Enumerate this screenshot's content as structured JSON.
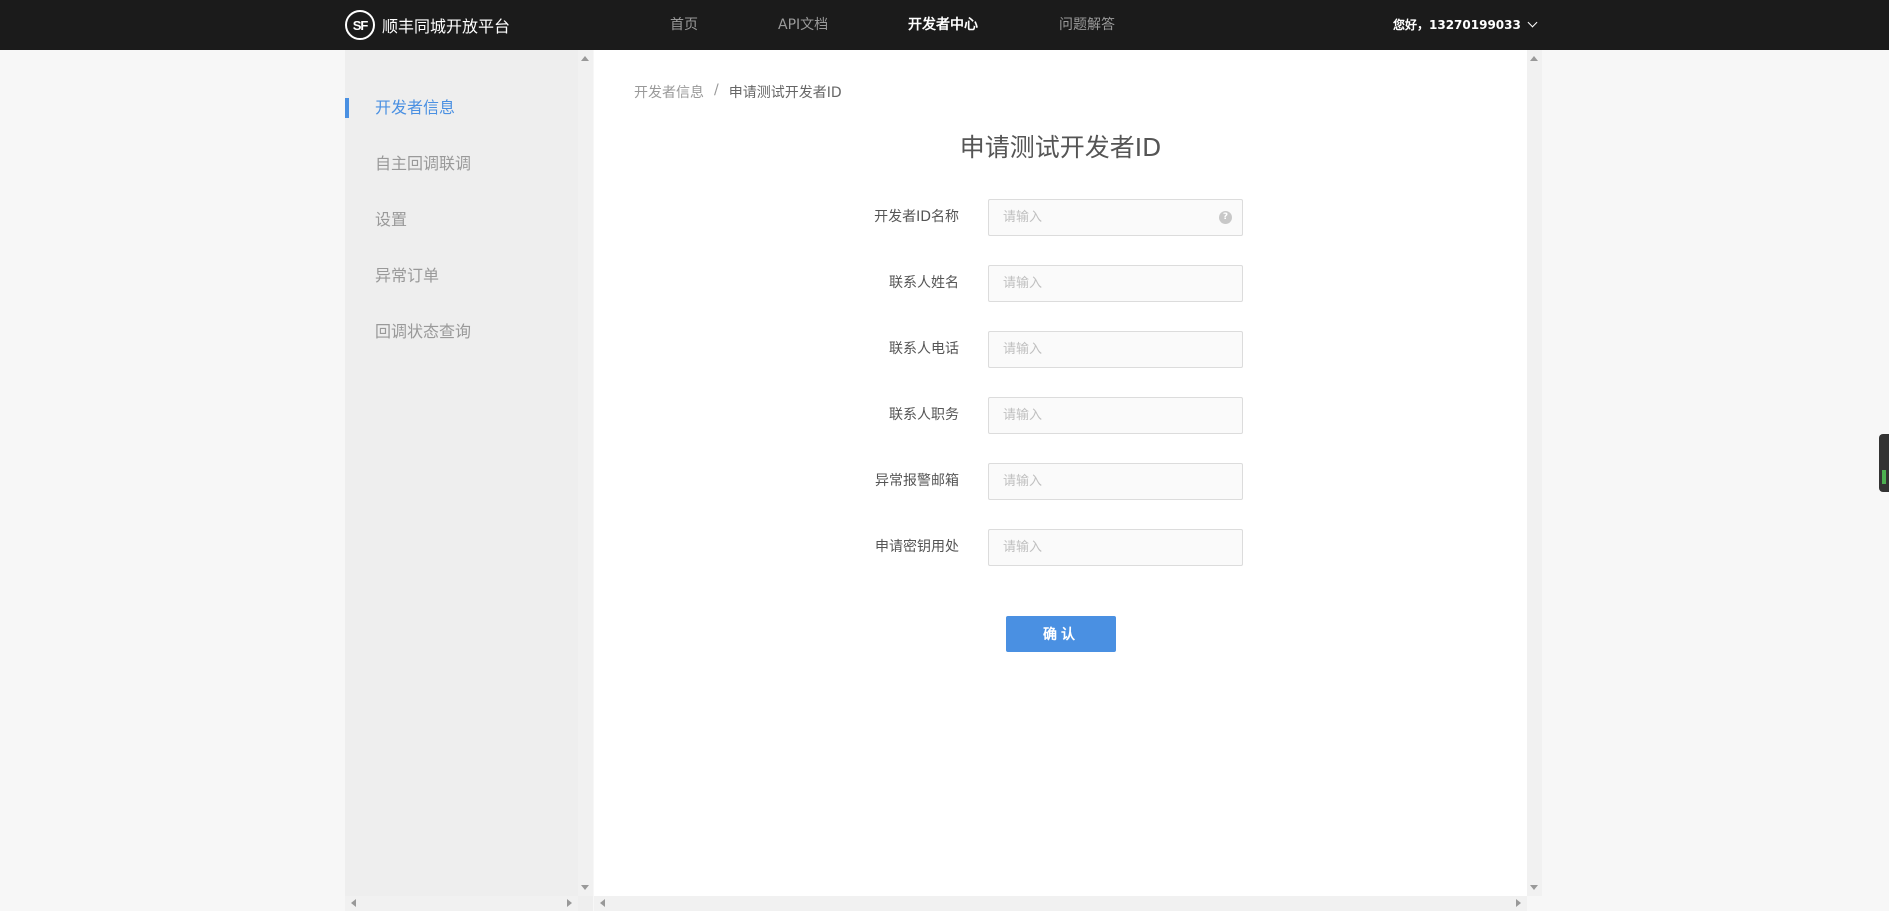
{
  "topbar": {
    "logo_mark": "SF",
    "logo_text": "顺丰同城开放平台",
    "nav": [
      "首页",
      "API文档",
      "开发者中心",
      "问题解答"
    ],
    "active_nav": "开发者中心",
    "user": "您好，13270199033"
  },
  "sidebar": {
    "items": [
      {
        "label": "开发者信息",
        "active": true
      },
      {
        "label": "自主回调联调",
        "active": false
      },
      {
        "label": "设置",
        "active": false
      },
      {
        "label": "异常订单",
        "active": false
      },
      {
        "label": "回调状态查询",
        "active": false
      }
    ]
  },
  "breadcrumb": {
    "parent": "开发者信息",
    "separator": "/",
    "current": "申请测试开发者ID"
  },
  "form": {
    "title": "申请测试开发者ID",
    "fields": [
      {
        "label": "开发者ID名称",
        "placeholder": "请输入",
        "value": "",
        "help": "?"
      },
      {
        "label": "联系人姓名",
        "placeholder": "请输入",
        "value": ""
      },
      {
        "label": "联系人电话",
        "placeholder": "请输入",
        "value": ""
      },
      {
        "label": "联系人职务",
        "placeholder": "请输入",
        "value": ""
      },
      {
        "label": "异常报警邮箱",
        "placeholder": "请输入",
        "value": ""
      },
      {
        "label": "申请密钥用处",
        "placeholder": "请输入",
        "value": ""
      }
    ],
    "submit_label": "确认"
  },
  "colors": {
    "accent": "#4a90e2",
    "topbar_bg": "#1b1b1b",
    "sidebar_bg": "#eeeeee"
  }
}
